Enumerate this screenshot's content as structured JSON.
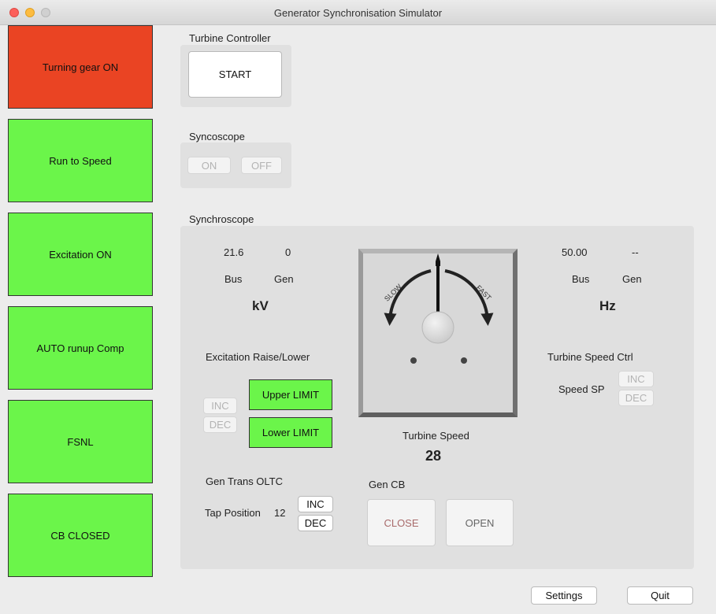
{
  "window": {
    "title": "Generator Synchronisation Simulator"
  },
  "status_panels": [
    {
      "label": "Turning gear ON",
      "color": "#ea4423"
    },
    {
      "label": "Run to Speed",
      "color": "#6bf54a"
    },
    {
      "label": "Excitation ON",
      "color": "#6bf54a"
    },
    {
      "label": "AUTO runup Comp",
      "color": "#6bf54a"
    },
    {
      "label": "FSNL",
      "color": "#6bf54a"
    },
    {
      "label": "CB CLOSED",
      "color": "#6bf54a"
    }
  ],
  "turbine_controller": {
    "label": "Turbine Controller",
    "start_label": "START"
  },
  "syncoscope": {
    "label": "Syncoscope",
    "on_label": "ON",
    "off_label": "OFF"
  },
  "synchroscope": {
    "label": "Synchroscope",
    "voltage": {
      "bus_value": "21.6",
      "gen_value": "0",
      "bus_label": "Bus",
      "gen_label": "Gen",
      "unit": "kV"
    },
    "frequency": {
      "bus_value": "50.00",
      "gen_value": "--",
      "bus_label": "Bus",
      "gen_label": "Gen",
      "unit": "Hz"
    },
    "dial": {
      "slow_label": "SLOW",
      "fast_label": "FAST"
    },
    "excitation": {
      "label": "Excitation Raise/Lower",
      "inc_label": "INC",
      "dec_label": "DEC",
      "upper_limit_label": "Upper LIMIT",
      "lower_limit_label": "Lower LIMIT"
    },
    "turbine_speed_ctrl": {
      "label": "Turbine Speed Ctrl",
      "speed_sp_label": "Speed SP",
      "inc_label": "INC",
      "dec_label": "DEC"
    },
    "turbine_speed": {
      "label": "Turbine Speed",
      "value": "28"
    },
    "gen_trans_oltc": {
      "label": "Gen Trans OLTC",
      "tap_label": "Tap Position",
      "tap_value": "12",
      "inc_label": "INC",
      "dec_label": "DEC"
    },
    "gen_cb": {
      "label": "Gen CB",
      "close_label": "CLOSE",
      "open_label": "OPEN"
    }
  },
  "footer": {
    "settings_label": "Settings",
    "quit_label": "Quit"
  }
}
